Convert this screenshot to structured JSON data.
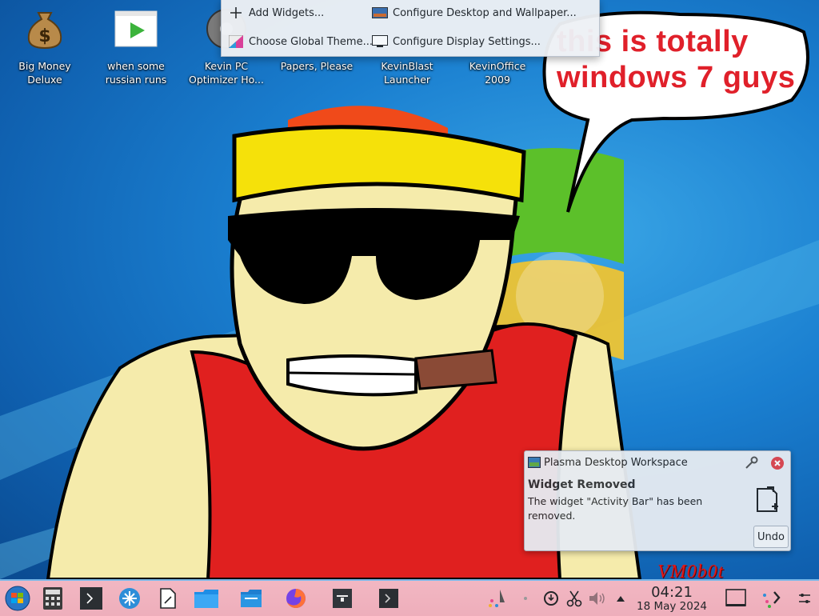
{
  "desktop": {
    "icons": [
      {
        "label": "Big Money\nDeluxe",
        "icon": "money-bag-icon"
      },
      {
        "label": "when some\nrussian runs a...",
        "icon": "video-player-icon"
      },
      {
        "label": "Kevin PC\nOptimizer Ho...",
        "icon": "disc-icon"
      },
      {
        "label": "Papers, Please",
        "icon": "game-icon"
      },
      {
        "label": "KevinBlast\nLauncher",
        "icon": "launcher-icon"
      },
      {
        "label": "KevinOffice\n2009",
        "icon": "office-icon"
      }
    ],
    "speech_bubble": {
      "text": "this is totally windows 7 guys"
    },
    "watermark": "VM0b0t"
  },
  "context_menu": {
    "items": [
      {
        "label": "Add Widgets...",
        "icon": "plus-icon"
      },
      {
        "label": "Configure Desktop and Wallpaper...",
        "icon": "wallpaper-icon"
      },
      {
        "label": "Choose Global Theme...",
        "icon": "theme-icon"
      },
      {
        "label": "Configure Display Settings...",
        "icon": "display-icon"
      }
    ]
  },
  "notification": {
    "app_name": "Plasma Desktop Workspace",
    "title": "Widget Removed",
    "body": "The widget \"Activity Bar\" has been removed.",
    "undo_label": "Undo",
    "icons": [
      "configure-icon",
      "close-icon",
      "add-document-icon"
    ]
  },
  "taskbar": {
    "start_icon": "windows-orb-icon",
    "pinned": [
      "calculator-icon",
      "terminal-icon",
      "network-icon",
      "document-icon",
      "folder-icon",
      "file-manager-icon",
      "firefox-icon",
      "archive-icon",
      "console-icon"
    ],
    "tray": [
      "kdeconnect-icon",
      "clipboard-icon",
      "updates-icon",
      "scissors-icon",
      "volume-icon",
      "expand-tray-icon"
    ],
    "clock": {
      "time": "04:21",
      "date": "18 May 2024"
    },
    "show_desktop_icon": "show-desktop-icon",
    "panel_tools": [
      "panel-edit-icon",
      "panel-settings-icon"
    ]
  },
  "colors": {
    "taskbar": "#eeaebb",
    "bubble_text": "#e0202a",
    "notification_bg": "#e7ecf2",
    "desktop_blue": "#1a7fd0"
  }
}
